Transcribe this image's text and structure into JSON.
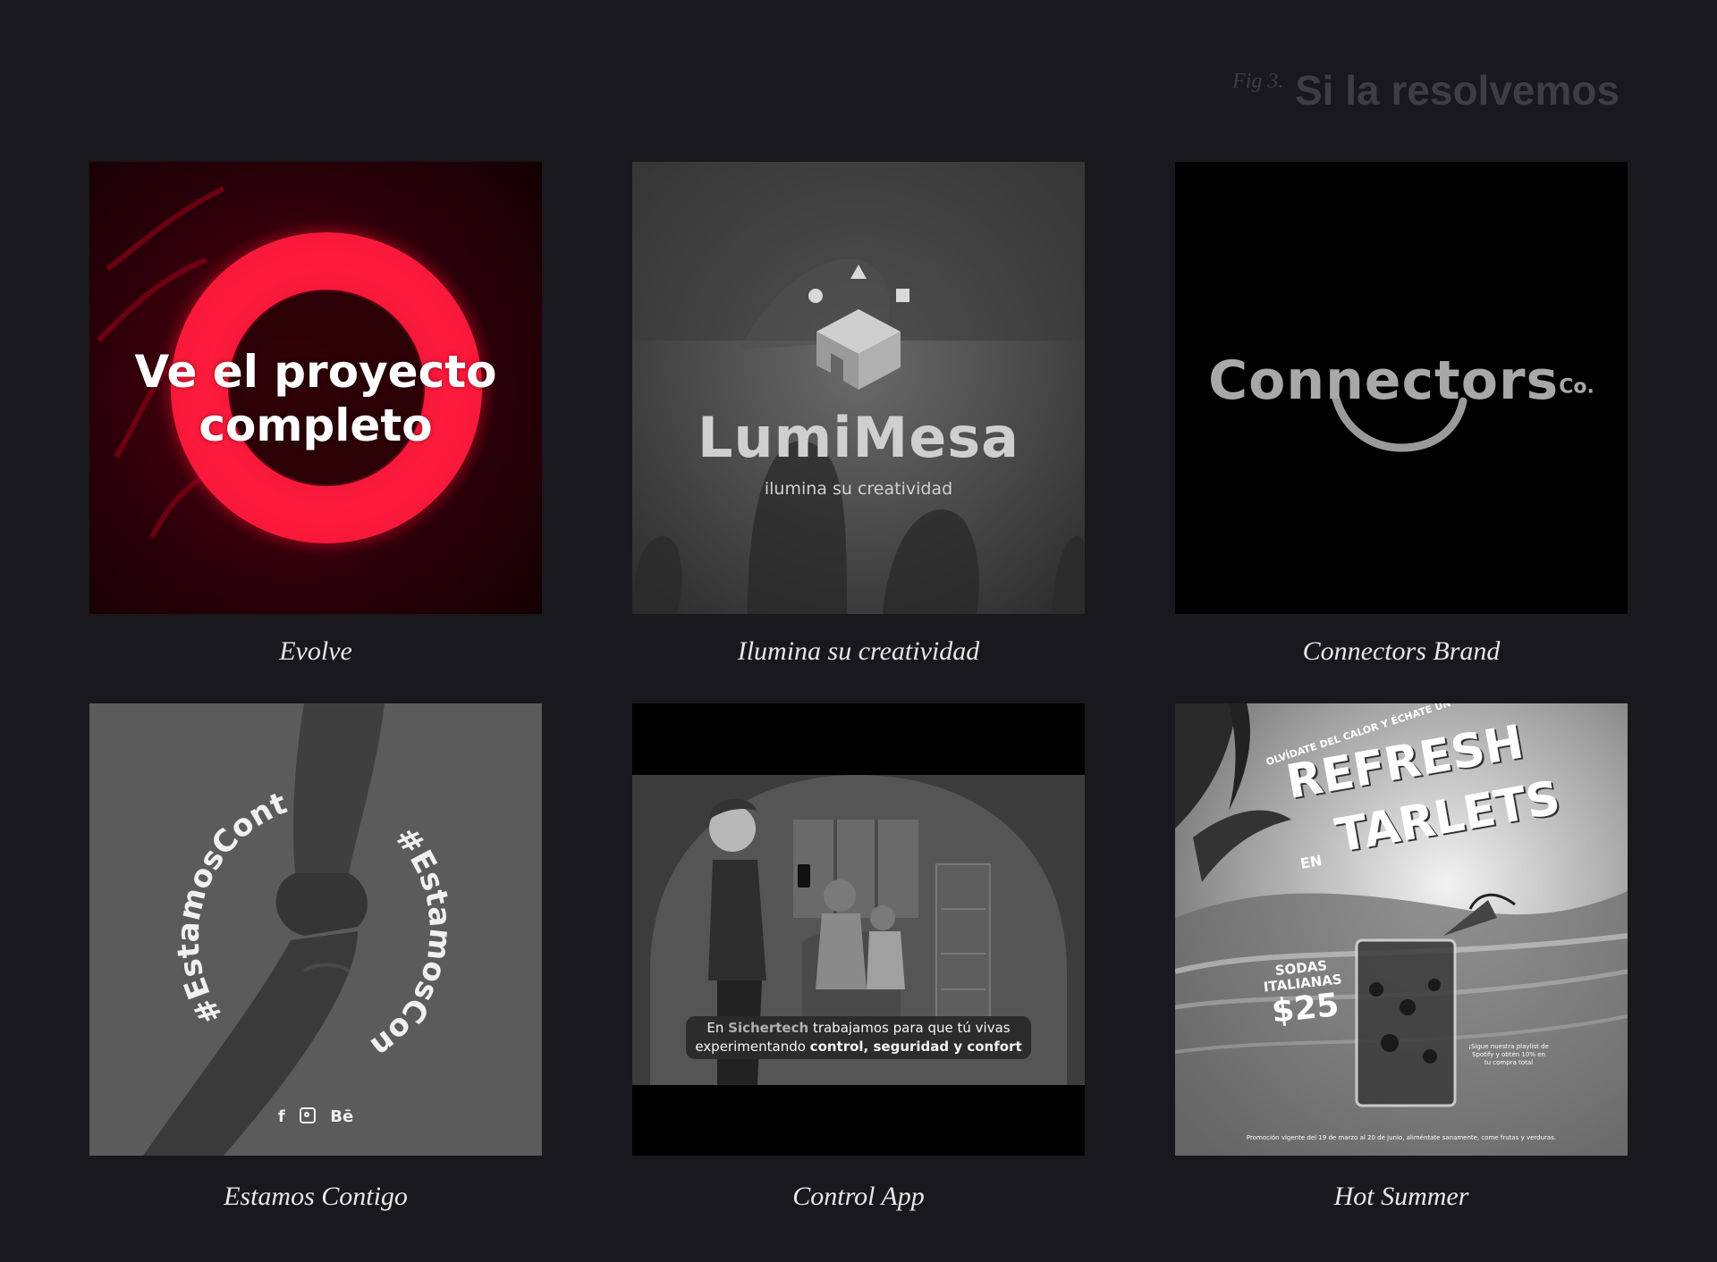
{
  "header": {
    "fig_label": "Fig 3.",
    "title": "Si la resolvemos"
  },
  "projects": [
    {
      "caption": "Evolve",
      "overlay": [
        "Ve el proyecto",
        "completo"
      ]
    },
    {
      "caption": "Ilumina su creatividad",
      "brand": "LumiMesa",
      "tagline": "ilumina su creatividad"
    },
    {
      "caption": "Connectors Brand",
      "brand": "Connectors",
      "brand_suffix": "Co."
    },
    {
      "caption": "Estamos Contigo",
      "hashtag": "#EstamosContigo",
      "social_icons": [
        "f",
        "instagram-icon",
        "Bē"
      ]
    },
    {
      "caption": "Control App",
      "subtitle_line1_pre": "En ",
      "subtitle_brand": "Sichertech",
      "subtitle_line1_post": " trabajamos para que tú vivas",
      "subtitle_line2_pre": "experimentando ",
      "subtitle_line2_bold": "control, seguridad y confort"
    },
    {
      "caption": "Hot Summer",
      "kicker": "OLVÍDATE DEL CALOR Y ÉCHATE UN",
      "headline1": "REFRESH",
      "headline_en": "EN",
      "headline2": "TARLETS",
      "product_line1": "SODAS",
      "product_line2": "ITALIANAS",
      "price": "$25",
      "promo_note1": "¡Sigue nuestra playlist de",
      "promo_note2": "Spotify y obtén 10% en",
      "promo_note3": "tu compra total",
      "footer_note": "Promoción vigente del 19 de marzo al 20 de junio, aliméntate sanamente, come frutas y verduras."
    }
  ],
  "colors": {
    "background": "#19181c",
    "accent_red": "#ff1a3c",
    "header_text": "#3e3d42",
    "caption_text": "#e8e8e8"
  }
}
